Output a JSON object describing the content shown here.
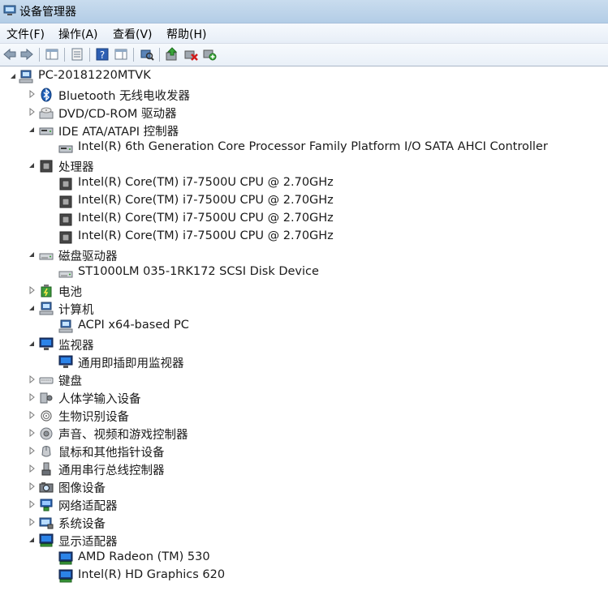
{
  "window": {
    "title": "设备管理器"
  },
  "menu": [
    {
      "label": "文件(F)"
    },
    {
      "label": "操作(A)"
    },
    {
      "label": "查看(V)"
    },
    {
      "label": "帮助(H)"
    }
  ],
  "toolbar": {
    "buttons": [
      {
        "icon": "back-arrow-icon"
      },
      {
        "icon": "forward-arrow-icon"
      },
      {
        "icon": "show-hide-console-tree-icon"
      },
      {
        "icon": "properties-icon"
      },
      {
        "icon": "help-icon"
      },
      {
        "icon": "action-pane-icon"
      },
      {
        "icon": "scan-hardware-changes-icon"
      },
      {
        "icon": "update-driver-icon"
      },
      {
        "icon": "uninstall-device-icon"
      },
      {
        "icon": "add-legacy-hardware-icon"
      }
    ]
  },
  "tree": [
    {
      "label": "PC-20181220MTVK",
      "level": 0,
      "state": "expanded",
      "icon": "computer-icon"
    },
    {
      "label": "Bluetooth 无线电收发器",
      "level": 1,
      "state": "collapsed",
      "icon": "bluetooth-icon"
    },
    {
      "label": "DVD/CD-ROM 驱动器",
      "level": 1,
      "state": "collapsed",
      "icon": "dvd-drive-icon"
    },
    {
      "label": "IDE ATA/ATAPI 控制器",
      "level": 1,
      "state": "expanded",
      "icon": "ide-controller-icon"
    },
    {
      "label": "Intel(R) 6th Generation Core Processor Family Platform I/O SATA AHCI Controller",
      "level": 2,
      "state": "leaf",
      "icon": "ide-controller-icon"
    },
    {
      "label": "处理器",
      "level": 1,
      "state": "expanded",
      "icon": "processor-icon"
    },
    {
      "label": "Intel(R) Core(TM) i7-7500U CPU @ 2.70GHz",
      "level": 2,
      "state": "leaf",
      "icon": "processor-icon"
    },
    {
      "label": "Intel(R) Core(TM) i7-7500U CPU @ 2.70GHz",
      "level": 2,
      "state": "leaf",
      "icon": "processor-icon"
    },
    {
      "label": "Intel(R) Core(TM) i7-7500U CPU @ 2.70GHz",
      "level": 2,
      "state": "leaf",
      "icon": "processor-icon"
    },
    {
      "label": "Intel(R) Core(TM) i7-7500U CPU @ 2.70GHz",
      "level": 2,
      "state": "leaf",
      "icon": "processor-icon"
    },
    {
      "label": "磁盘驱动器",
      "level": 1,
      "state": "expanded",
      "icon": "disk-drive-icon"
    },
    {
      "label": "ST1000LM 035-1RK172 SCSI Disk Device",
      "level": 2,
      "state": "leaf",
      "icon": "disk-drive-icon"
    },
    {
      "label": "电池",
      "level": 1,
      "state": "collapsed",
      "icon": "battery-icon"
    },
    {
      "label": "计算机",
      "level": 1,
      "state": "expanded",
      "icon": "computer-icon"
    },
    {
      "label": "ACPI x64-based PC",
      "level": 2,
      "state": "leaf",
      "icon": "computer-icon"
    },
    {
      "label": "监视器",
      "level": 1,
      "state": "expanded",
      "icon": "monitor-icon"
    },
    {
      "label": "通用即插即用监视器",
      "level": 2,
      "state": "leaf",
      "icon": "monitor-icon"
    },
    {
      "label": "键盘",
      "level": 1,
      "state": "collapsed",
      "icon": "keyboard-icon"
    },
    {
      "label": "人体学输入设备",
      "level": 1,
      "state": "collapsed",
      "icon": "hid-icon"
    },
    {
      "label": "生物识别设备",
      "level": 1,
      "state": "collapsed",
      "icon": "biometric-icon"
    },
    {
      "label": "声音、视频和游戏控制器",
      "level": 1,
      "state": "collapsed",
      "icon": "speaker-icon"
    },
    {
      "label": "鼠标和其他指针设备",
      "level": 1,
      "state": "collapsed",
      "icon": "mouse-icon"
    },
    {
      "label": "通用串行总线控制器",
      "level": 1,
      "state": "collapsed",
      "icon": "usb-icon"
    },
    {
      "label": "图像设备",
      "level": 1,
      "state": "collapsed",
      "icon": "camera-icon"
    },
    {
      "label": "网络适配器",
      "level": 1,
      "state": "collapsed",
      "icon": "network-adapter-icon"
    },
    {
      "label": "系统设备",
      "level": 1,
      "state": "collapsed",
      "icon": "system-device-icon"
    },
    {
      "label": "显示适配器",
      "level": 1,
      "state": "expanded",
      "icon": "display-adapter-icon"
    },
    {
      "label": "AMD Radeon (TM) 530",
      "level": 2,
      "state": "leaf",
      "icon": "display-adapter-icon"
    },
    {
      "label": "Intel(R) HD Graphics 620",
      "level": 2,
      "state": "leaf",
      "icon": "display-adapter-icon"
    }
  ]
}
